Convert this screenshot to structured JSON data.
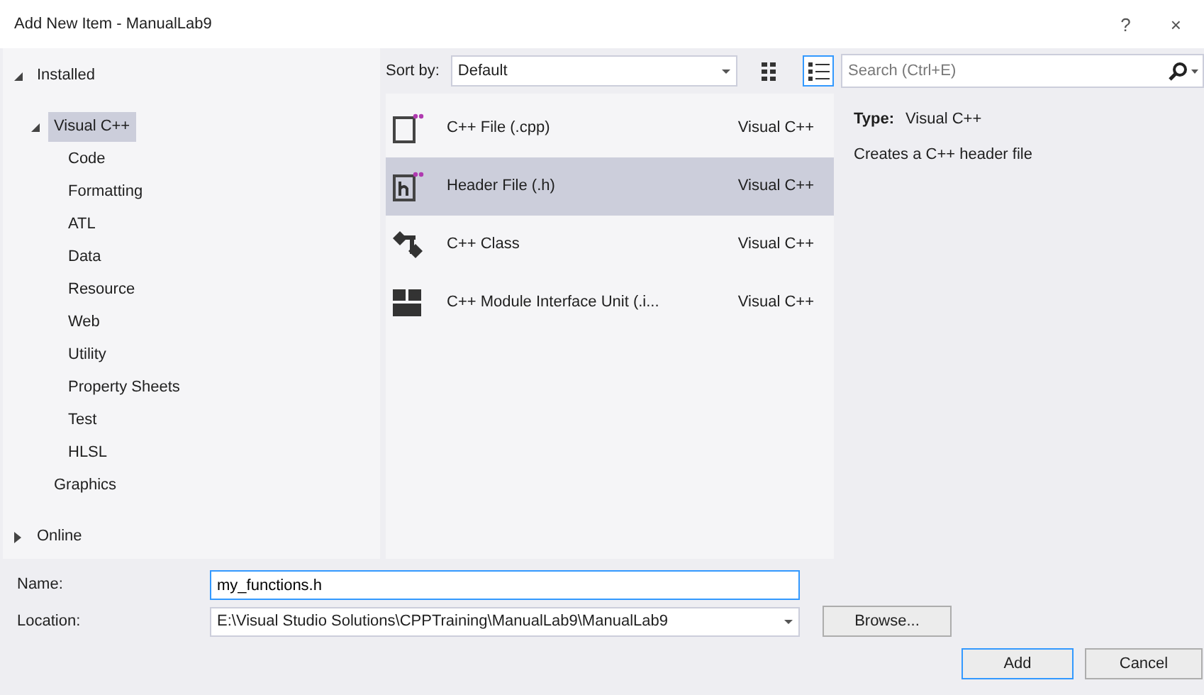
{
  "window": {
    "title": "Add New Item - ManualLab9",
    "help_button": "?",
    "close_button": "×"
  },
  "tree": [
    {
      "label": "Installed",
      "expanded": true,
      "selected": false,
      "children": [
        {
          "label": "Visual C++",
          "expanded": true,
          "selected": true,
          "children": [
            {
              "label": "Code",
              "selected": false
            },
            {
              "label": "Formatting",
              "selected": false
            },
            {
              "label": "ATL",
              "selected": false
            },
            {
              "label": "Data",
              "selected": false
            },
            {
              "label": "Resource",
              "selected": false
            },
            {
              "label": "Web",
              "selected": false
            },
            {
              "label": "Utility",
              "selected": false
            },
            {
              "label": "Property Sheets",
              "selected": false
            },
            {
              "label": "Test",
              "selected": false
            },
            {
              "label": "HLSL",
              "selected": false
            }
          ]
        },
        {
          "label": "Graphics",
          "selected": false
        }
      ]
    },
    {
      "label": "Online",
      "expanded": false,
      "selected": false
    }
  ],
  "toolbar": {
    "sort_label": "Sort by:",
    "sort_value": "Default",
    "views": [
      {
        "kind": "grid",
        "selected": false
      },
      {
        "kind": "list",
        "selected": true
      }
    ]
  },
  "search": {
    "placeholder": "Search (Ctrl+E)"
  },
  "templates": [
    {
      "kind": "cpp",
      "name": "C++ File (.cpp)",
      "language": "Visual C++",
      "selected": false
    },
    {
      "kind": "header",
      "name": "Header File (.h)",
      "language": "Visual C++",
      "selected": true
    },
    {
      "kind": "class",
      "name": "C++ Class",
      "language": "Visual C++",
      "selected": false
    },
    {
      "kind": "module",
      "name": "C++ Module Interface Unit (.i...",
      "language": "Visual C++",
      "selected": false
    }
  ],
  "details": {
    "type_label": "Type:",
    "type_value": "Visual C++",
    "description": "Creates a C++ header file"
  },
  "form": {
    "name_label": "Name:",
    "name_value": "my_functions.h",
    "location_label": "Location:",
    "location_value": "E:\\Visual Studio Solutions\\CPPTraining\\ManualLab9\\ManualLab9",
    "browse_button": "Browse...",
    "add_button": "Add",
    "cancel_button": "Cancel"
  }
}
